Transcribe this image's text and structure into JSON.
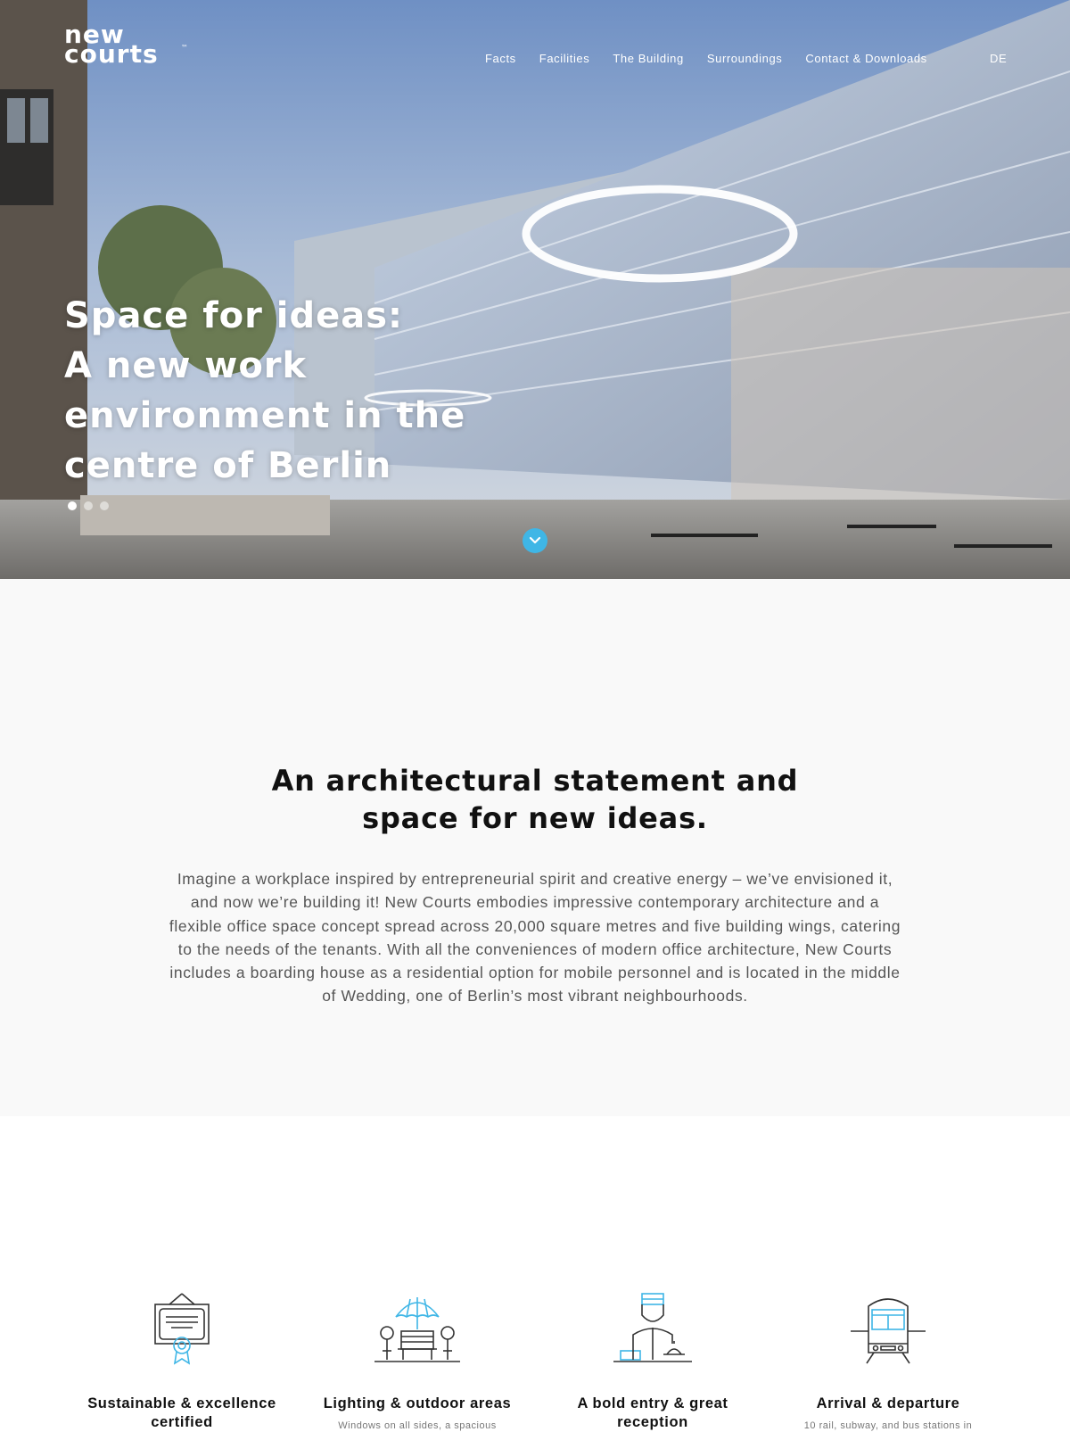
{
  "brand": {
    "logo_line1": "new",
    "logo_line2": "courts",
    "logo_tm": "™"
  },
  "nav": {
    "items": [
      "Facts",
      "Facilities",
      "The Building",
      "Surroundings",
      "Contact & Downloads"
    ],
    "language": "DE"
  },
  "hero": {
    "title_lines": [
      "Space for ideas:",
      "A new work",
      "environment in the",
      "centre of Berlin"
    ],
    "slides": {
      "count": 3,
      "active_index": 0
    }
  },
  "intro": {
    "heading_lines": [
      "An architectural statement and",
      "space for new ideas."
    ],
    "body": "Imagine a workplace inspired by entrepreneurial spirit and creative energy – we’ve envisioned it, and now we’re building it! New Courts embodies impressive contemporary architecture and a flexible office space concept spread across 20,000 square metres and five building wings, catering to the needs of the tenants. With all the conveniences of modern office architecture, New Courts includes a boarding house as a residential option for mobile personnel and is located in the middle of Wedding, one of Berlin’s most vibrant neighbourhoods."
  },
  "features": [
    {
      "icon": "certificate-icon",
      "title": "Sustainable & excellence certified",
      "description": ""
    },
    {
      "icon": "outdoor-bench-umbrella-icon",
      "title": "Lighting & outdoor areas",
      "description": "Windows on all sides, a spacious"
    },
    {
      "icon": "concierge-icon",
      "title": "A bold entry & great reception",
      "description": ""
    },
    {
      "icon": "train-icon",
      "title": "Arrival & departure",
      "description": "10 rail, subway, and bus stations in"
    }
  ],
  "colors": {
    "accent": "#3fb6e6",
    "icon_stroke": "#333333",
    "text_dark": "#111111",
    "text_body": "#555555",
    "intro_bg": "#f9f9f9"
  }
}
